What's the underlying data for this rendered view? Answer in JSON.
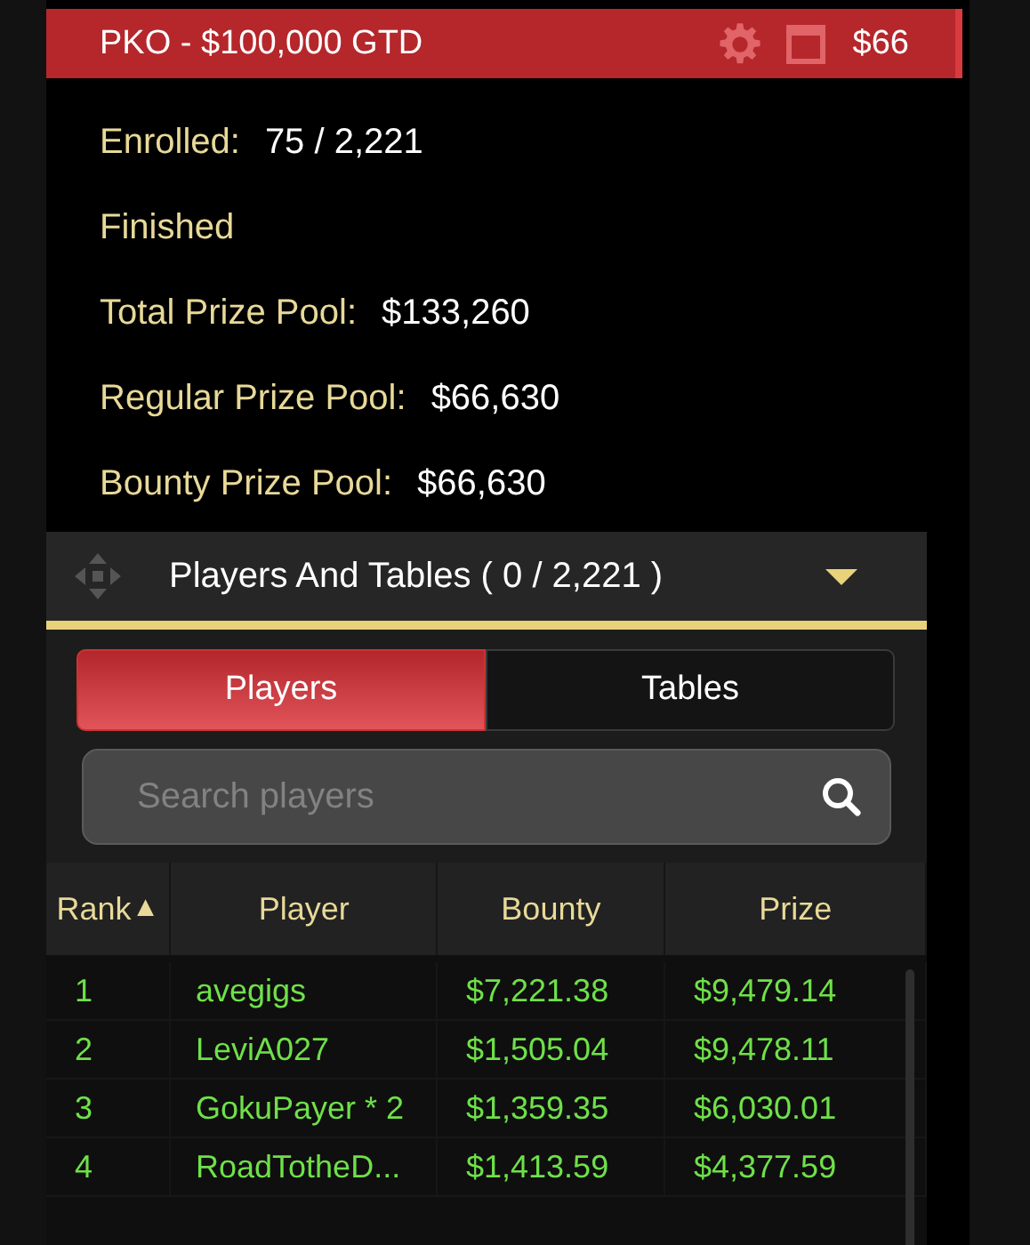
{
  "header": {
    "title": "PKO - $100,000 GTD",
    "buyin": "$66"
  },
  "info": [
    {
      "label": "Enrolled:",
      "value": "75 / 2,221"
    },
    {
      "label": "Finished"
    },
    {
      "label": "Total Prize Pool:",
      "value": "$133,260"
    },
    {
      "label": "Regular Prize Pool:",
      "value": "$66,630"
    },
    {
      "label": "Bounty Prize Pool:",
      "value": "$66,630"
    }
  ],
  "section": {
    "title": "Players And Tables ( 0 / 2,221 )",
    "expanded": true
  },
  "tabs": [
    {
      "label": "Players",
      "selected": true
    },
    {
      "label": "Tables",
      "selected": false
    }
  ],
  "search": {
    "placeholder": "Search players"
  },
  "table": {
    "columns": [
      {
        "label": "Rank",
        "sort_mark": "▲"
      },
      {
        "label": "Player"
      },
      {
        "label": "Bounty"
      },
      {
        "label": "Prize"
      }
    ],
    "rows": [
      [
        "1",
        "avegigs",
        "$7,221.38",
        "$9,479.14"
      ],
      [
        "2",
        "LeviA027",
        "$1,505.04",
        "$9,478.11"
      ],
      [
        "3",
        "GokuPayer * 2",
        "$1,359.35",
        "$6,030.01"
      ],
      [
        "4",
        "RoadTotheD...",
        "$1,413.59",
        "$4,377.59"
      ]
    ]
  }
}
